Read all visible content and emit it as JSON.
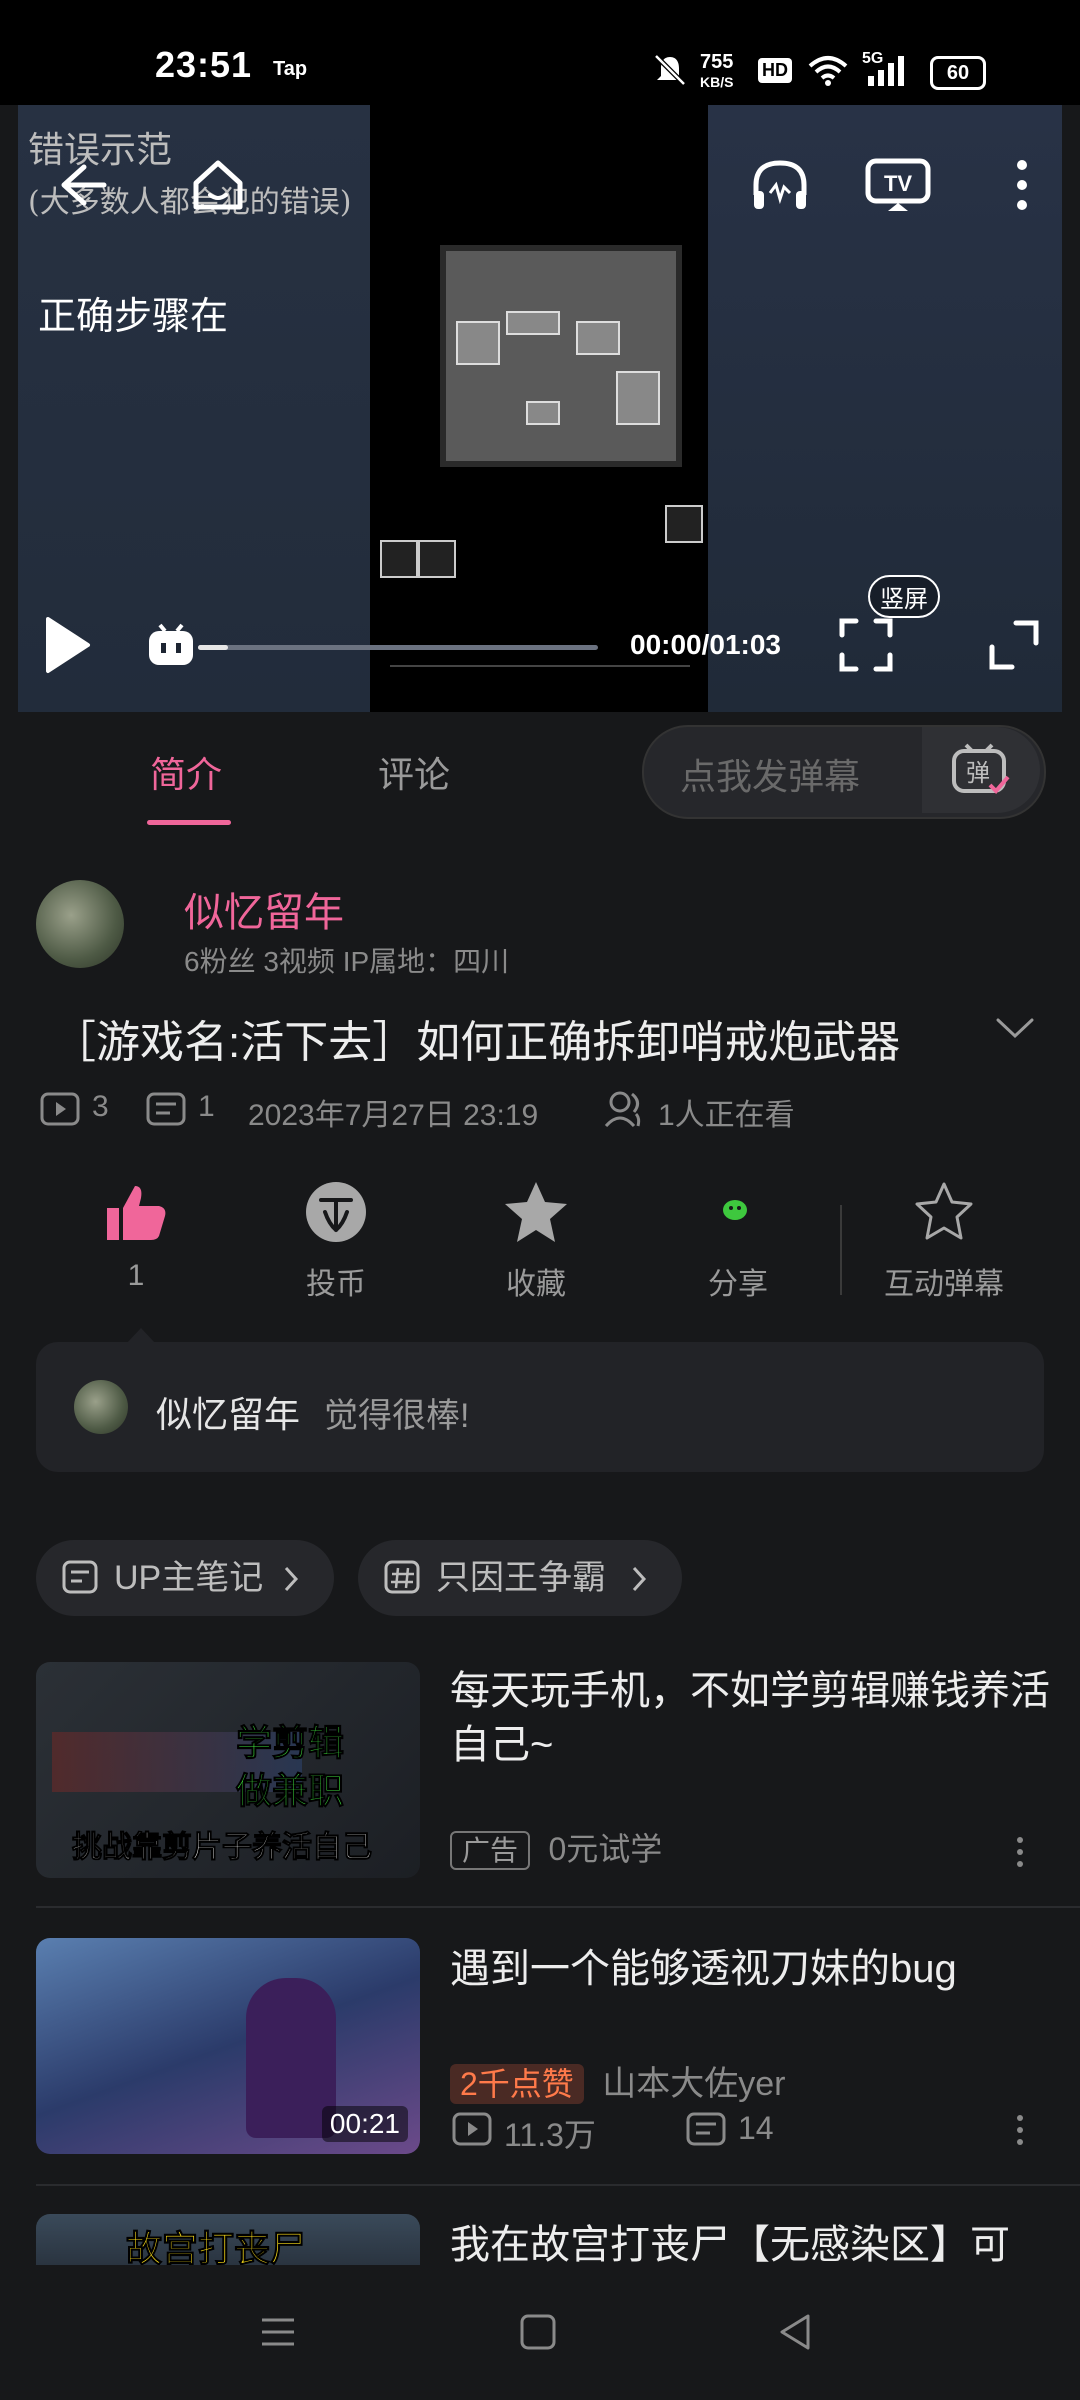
{
  "status_bar": {
    "time": "23:51",
    "carrier_badge": "Tap",
    "net_speed_value": "755",
    "net_speed_unit": "KB/S",
    "hd_label": "HD",
    "signal_label": "5G",
    "battery_level": "60"
  },
  "video": {
    "overlay_line1": "错误示范",
    "overlay_line2": "(大多数人都会犯的错误)",
    "overlay_line3": "正确步骤在",
    "current_time": "00:00/01:03",
    "portrait_label": "竖屏",
    "progress_fraction": 0.0
  },
  "tabs": {
    "intro": "简介",
    "comments": "评论",
    "danmaku_placeholder": "点我发弹幕",
    "danmaku_icon_label": "弹"
  },
  "uploader": {
    "name": "似忆留年",
    "meta": "6粉丝   3视频   IP属地：四川"
  },
  "video_info": {
    "title": "［游戏名:活下去］如何正确拆卸哨戒炮武器",
    "plays": "3",
    "danmaku_count": "1",
    "date": "2023年7月27日 23:19",
    "watching": "1人正在看"
  },
  "actions": {
    "like_count": "1",
    "coin": "投币",
    "favorite": "收藏",
    "share": "分享",
    "interactive_danmaku": "互动弹幕"
  },
  "like_banner": {
    "name": "似忆留年",
    "text": "觉得很棒!"
  },
  "chips": [
    {
      "label": "UP主笔记"
    },
    {
      "label": "只因王争霸"
    }
  ],
  "feed": [
    {
      "title": "每天玩手机，不如学剪辑赚钱养活自己~",
      "thumb_text_1": "学剪辑",
      "thumb_text_2": "做兼职",
      "thumb_text_3": "挑战靠剪片子养活自己",
      "ad_tag": "广告",
      "ad_sub": "0元试学"
    },
    {
      "title": "遇到一个能够透视刀妹的bug",
      "duration": "00:21",
      "badge": "2千点赞",
      "author": "山本大佐yer",
      "plays": "11.3万",
      "danmaku": "14"
    },
    {
      "title": "我在故宫打丧尸【无感染区】可",
      "thumb_text": "故宫打丧尸"
    }
  ],
  "colors": {
    "accent": "#f0669a",
    "background": "#17181a",
    "share_green": "#3ec83e"
  }
}
